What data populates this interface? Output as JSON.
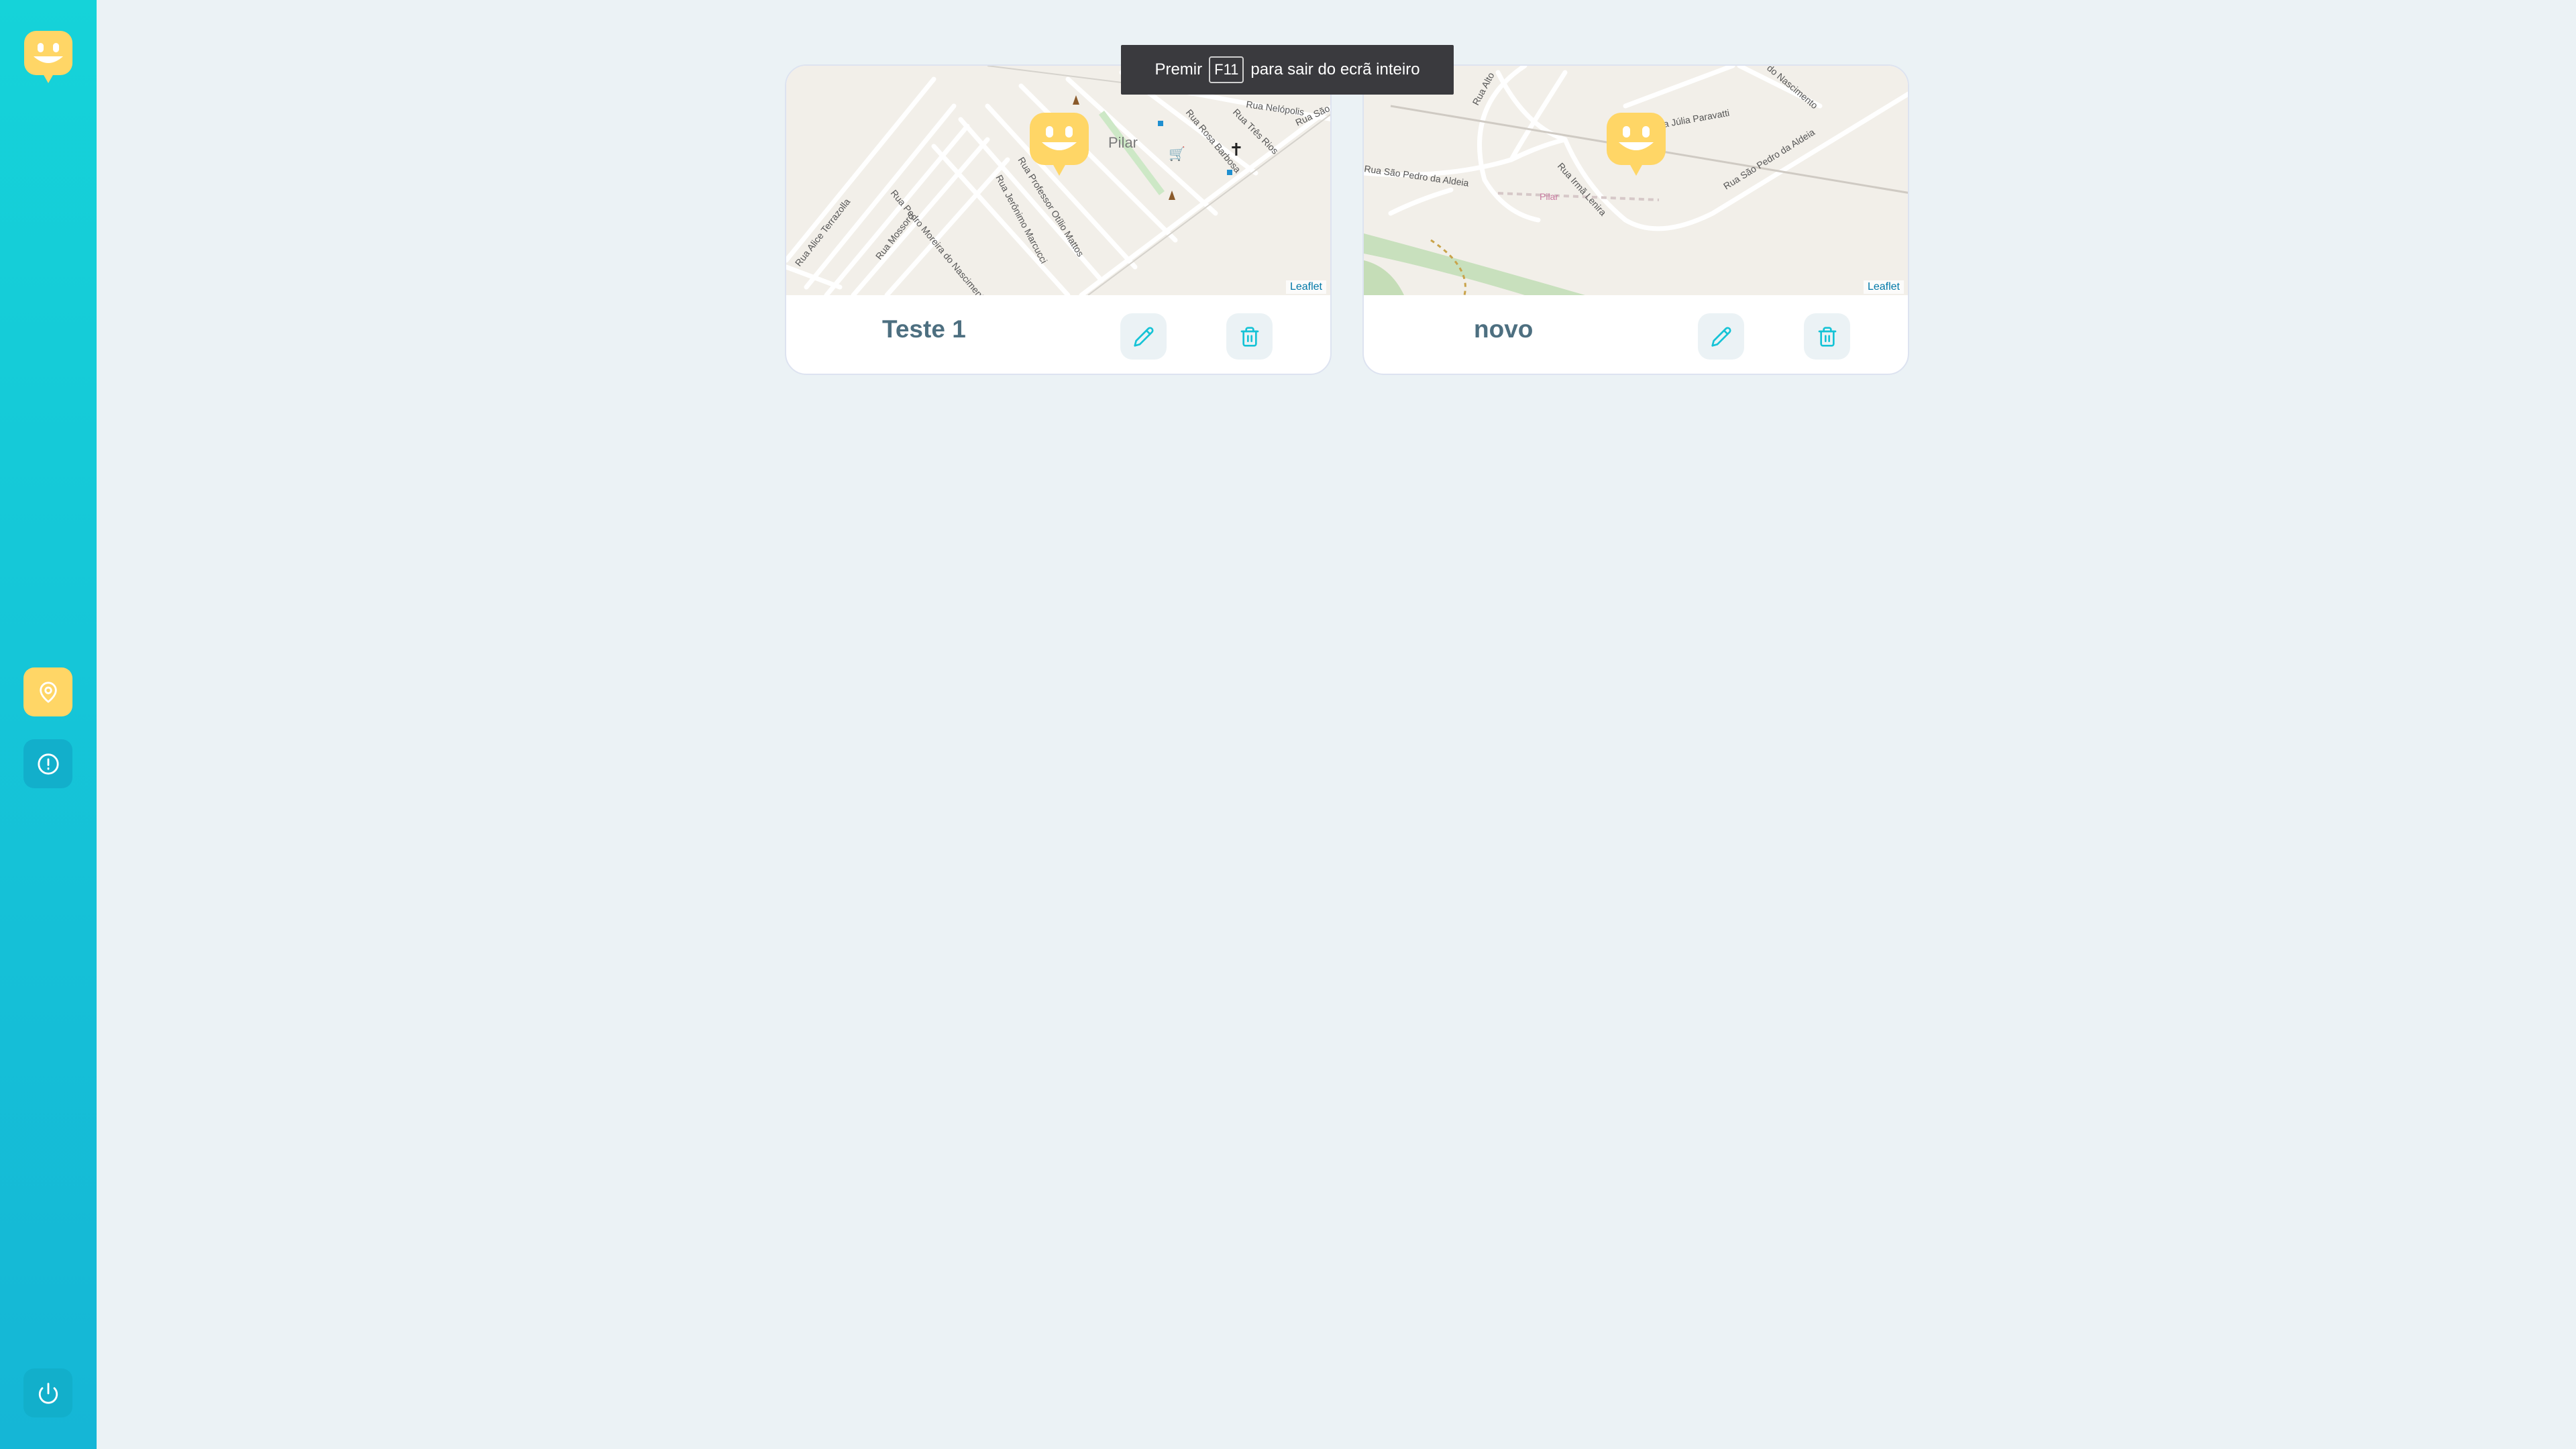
{
  "sidebar": {
    "logo_icon": "happy-balloon-logo",
    "nav": [
      {
        "icon": "map-pin-icon",
        "active": true
      },
      {
        "icon": "info-icon",
        "active": false
      }
    ],
    "logout_icon": "power-icon"
  },
  "toast": {
    "prefix": "Premir",
    "key": "F11",
    "suffix": "para sair do ecrã inteiro"
  },
  "cards": [
    {
      "title": "Teste 1",
      "attribution": "Leaflet",
      "map_labels": [
        "Pilar",
        "Rua Alice Terrazolla",
        "Rua Pedro Moreira do Nascimento",
        "Rua Mossoró",
        "Rua Jerônimo Marcucci",
        "Rua Professor Otílio Mattos",
        "Rua Rosa Barbosa",
        "Rua Nelópolis",
        "Rua Três Rios",
        "Rua São P"
      ]
    },
    {
      "title": "novo",
      "attribution": "Leaflet",
      "map_labels": [
        "Rua São Pedro da Aldeia",
        "Rua Júlia Paravatti",
        "Rua Irmã Lenira",
        "Rua São Pedro da Aldeia",
        "do Nascimento",
        "Pilar",
        "Rua Alto"
      ]
    }
  ],
  "colors": {
    "accent": "#15c3d6",
    "yellow": "#ffd666",
    "title": "#4d6f80",
    "background": "#ebf2f5"
  }
}
